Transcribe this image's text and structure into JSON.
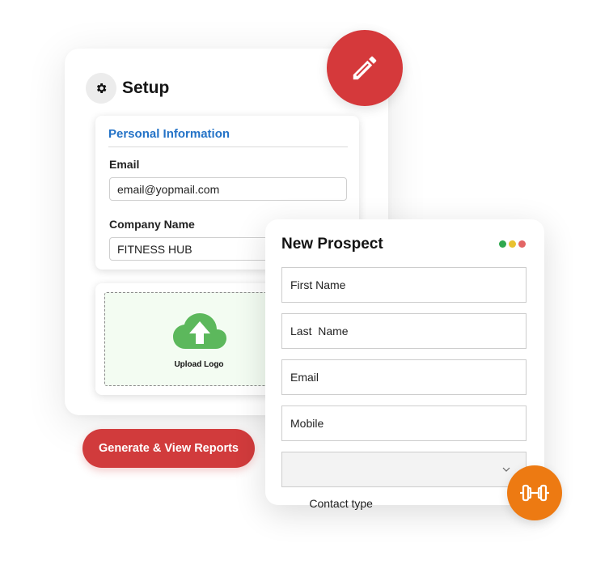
{
  "setup": {
    "title": "Setup",
    "icon": "gear-icon",
    "personal_info": {
      "title": "Personal Information",
      "email_label": "Email",
      "email_value": "email@yopmail.com",
      "company_label": "Company Name",
      "company_value": "FITNESS HUB"
    },
    "upload": {
      "label": "Upload Logo",
      "icon": "cloud-upload-icon",
      "color": "#5cb85c"
    }
  },
  "edit_button": {
    "icon": "pencil-icon",
    "color": "#d5393b"
  },
  "generate_button": {
    "label": "Generate & View Reports",
    "color": "#d13b3c"
  },
  "prospect": {
    "title": "New Prospect",
    "window_dots": [
      "#2fa84f",
      "#e9c230",
      "#e36565"
    ],
    "fields": {
      "first_name": "First Name",
      "last_name": "Last  Name",
      "email": "Email",
      "mobile": "Mobile",
      "contact_type": "Contact type"
    }
  },
  "dumbbell_badge": {
    "icon": "dumbbell-icon",
    "color": "#ed7a12"
  }
}
